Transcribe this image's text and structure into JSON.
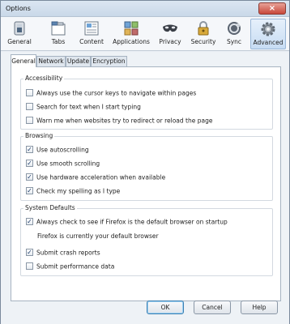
{
  "window": {
    "title": "Options",
    "close_glyph": "×"
  },
  "toolbar": {
    "panes": [
      {
        "label": "General",
        "icon": "switch-icon"
      },
      {
        "label": "Tabs",
        "icon": "tabs-icon"
      },
      {
        "label": "Content",
        "icon": "content-icon"
      },
      {
        "label": "Applications",
        "icon": "applications-icon"
      },
      {
        "label": "Privacy",
        "icon": "privacy-mask-icon"
      },
      {
        "label": "Security",
        "icon": "lock-icon"
      },
      {
        "label": "Sync",
        "icon": "sync-icon"
      },
      {
        "label": "Advanced",
        "icon": "gear-icon",
        "selected": true
      }
    ]
  },
  "tabs": [
    {
      "label": "General",
      "active": true
    },
    {
      "label": "Network"
    },
    {
      "label": "Update"
    },
    {
      "label": "Encryption"
    }
  ],
  "accessibility": {
    "legend": "Accessibility",
    "items": [
      {
        "label": "Always use the cursor keys to navigate within pages",
        "checked": false
      },
      {
        "label": "Search for text when I start typing",
        "checked": false
      },
      {
        "label": "Warn me when websites try to redirect or reload the page",
        "checked": false
      }
    ]
  },
  "browsing": {
    "legend": "Browsing",
    "items": [
      {
        "label": "Use autoscrolling",
        "checked": true
      },
      {
        "label": "Use smooth scrolling",
        "checked": true
      },
      {
        "label": "Use hardware acceleration when available",
        "checked": true
      },
      {
        "label": "Check my spelling as I type",
        "checked": true
      }
    ]
  },
  "system_defaults": {
    "legend": "System Defaults",
    "default_check": {
      "label": "Always check to see if Firefox is the default browser on startup",
      "checked": true
    },
    "default_status": "Firefox is currently your default browser",
    "items": [
      {
        "label": "Submit crash reports",
        "checked": true
      },
      {
        "label": "Submit performance data",
        "checked": false
      }
    ]
  },
  "buttons": {
    "ok": "OK",
    "cancel": "Cancel",
    "help": "Help"
  },
  "check_glyph": "✓",
  "colors": {
    "accent": "#3c7fb1",
    "selected_pane": "#c7dcf3"
  }
}
